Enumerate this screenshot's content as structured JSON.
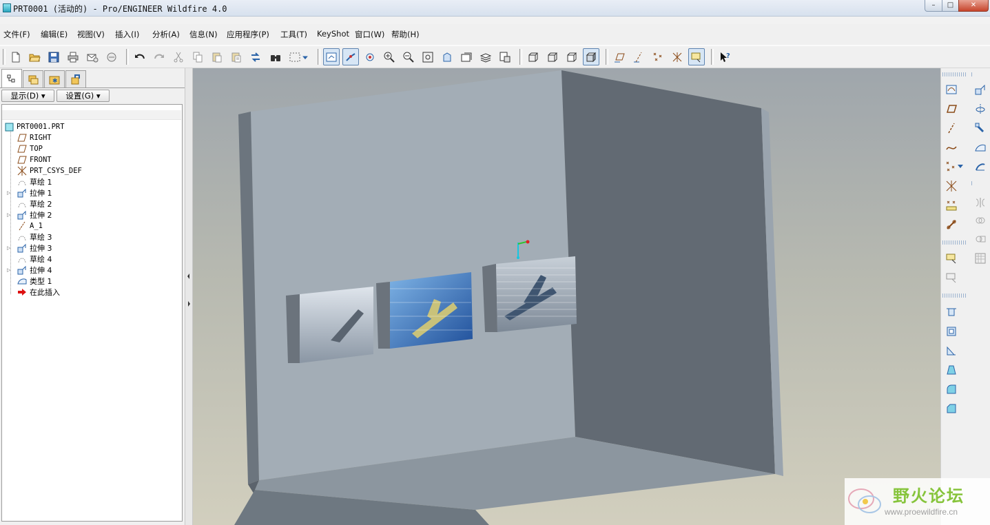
{
  "window": {
    "title": "PRT0001 (活动的) - Pro/ENGINEER Wildfire 4.0",
    "min_glyph": "–",
    "max_glyph": "□",
    "close_glyph": "✕"
  },
  "menu": [
    "文件(F)",
    "编辑(E)",
    "视图(V)",
    "插入(I)",
    "分析(A)",
    "信息(N)",
    "应用程序(P)",
    "工具(T)",
    "KeyShot",
    "窗口(W)",
    "帮助(H)"
  ],
  "left_panel": {
    "show_button": "显示(D) ▾",
    "settings_button": "设置(G) ▾",
    "tree": [
      {
        "label": "PRT0001.PRT",
        "icon": "part-icon"
      },
      {
        "label": "RIGHT",
        "icon": "datum-plane-icon"
      },
      {
        "label": "TOP",
        "icon": "datum-plane-icon"
      },
      {
        "label": "FRONT",
        "icon": "datum-plane-icon"
      },
      {
        "label": "PRT_CSYS_DEF",
        "icon": "csys-icon"
      },
      {
        "label": "草绘 1",
        "icon": "sketch-icon"
      },
      {
        "label": "拉伸 1",
        "icon": "extrude-icon",
        "expandable": true
      },
      {
        "label": "草绘 2",
        "icon": "sketch-icon"
      },
      {
        "label": "拉伸 2",
        "icon": "extrude-icon",
        "expandable": true
      },
      {
        "label": "A_1",
        "icon": "axis-icon"
      },
      {
        "label": "草绘 3",
        "icon": "sketch-icon"
      },
      {
        "label": "拉伸 3",
        "icon": "extrude-icon",
        "expandable": true
      },
      {
        "label": "草绘 4",
        "icon": "sketch-icon"
      },
      {
        "label": "拉伸 4",
        "icon": "extrude-icon",
        "expandable": true
      },
      {
        "label": "类型 1",
        "icon": "surface-icon"
      },
      {
        "label": "在此插入",
        "icon": "insert-here-arrow-icon"
      }
    ]
  },
  "watermark": {
    "name": "野火论坛",
    "url": "www.proewildfire.cn"
  },
  "colors": {
    "viewport_top": "#9fa6ac",
    "viewport_bottom": "#d2cfbe",
    "model_face": "#a3adb6",
    "model_dark": "#626a73",
    "accent_blue": "#2a63a8",
    "feature_icon_brown": "#8a4a17"
  }
}
